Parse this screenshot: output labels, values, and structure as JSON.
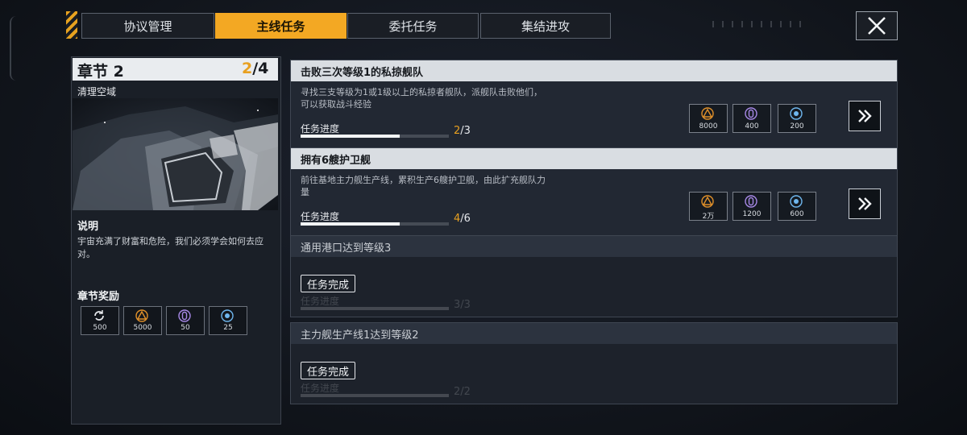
{
  "tabs": [
    {
      "label": "协议管理",
      "active": false
    },
    {
      "label": "主线任务",
      "active": true
    },
    {
      "label": "委托任务",
      "active": false
    },
    {
      "label": "集结进攻",
      "active": false
    }
  ],
  "chapter": {
    "title": "章节 2",
    "progress_current": "2",
    "progress_total": "/4",
    "subtitle": "清理空域",
    "description_title": "说明",
    "description": "宇宙充满了财富和危险，我们必须学会如何去应对。",
    "rewards_title": "章节奖励",
    "rewards": [
      {
        "icon": "cycle-icon",
        "value": "500"
      },
      {
        "icon": "triangle-resource-icon",
        "value": "5000"
      },
      {
        "icon": "crystal-icon",
        "value": "50"
      },
      {
        "icon": "energy-orb-icon",
        "value": "25"
      }
    ]
  },
  "progress_label": "任务进度",
  "done_label": "任务完成",
  "missions": [
    {
      "title": "击败三次等级1的私掠舰队",
      "desc": "寻找三支等级为1或1级以上的私掠者舰队，派舰队击败他们，可以获取战斗经验",
      "current": "2",
      "total": "/3",
      "fraction": 0.667,
      "state": "active",
      "rewards": [
        "8000",
        "400",
        "200"
      ]
    },
    {
      "title": "拥有6艘护卫舰",
      "desc": "前往基地主力舰生产线，累积生产6艘护卫舰，由此扩充舰队力量",
      "current": "4",
      "total": "/6",
      "fraction": 0.667,
      "state": "active",
      "rewards": [
        "2万",
        "1200",
        "600"
      ]
    },
    {
      "title": "通用港口达到等级3",
      "current": "3",
      "total": "/3",
      "fraction": 1.0,
      "state": "done"
    },
    {
      "title": "主力舰生产线1达到等级2",
      "current": "2",
      "total": "/2",
      "fraction": 1.0,
      "state": "done"
    }
  ],
  "colors": {
    "accent": "#f3a823",
    "panel": "#222833",
    "header_light": "#d9dde2"
  }
}
